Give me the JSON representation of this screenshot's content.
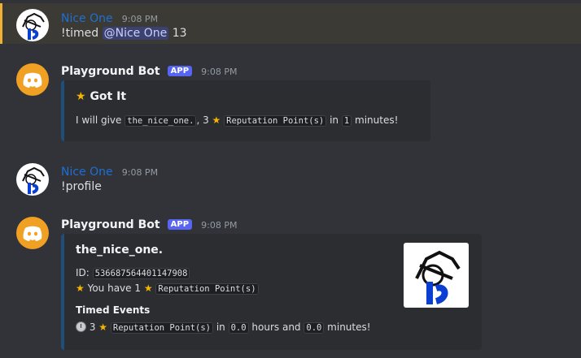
{
  "messages": [
    {
      "author": "Nice One",
      "time": "9:08 PM",
      "content_prefix": "!timed",
      "mention": "@Nice One",
      "content_suffix": "13"
    },
    {
      "author": "Playground Bot",
      "badge": "APP",
      "time": "9:08 PM",
      "embed": {
        "title": "Got It",
        "text_1": "I will give",
        "user_code": "the_nice_one.",
        "text_2": ", 3",
        "points_code": "Reputation Point(s)",
        "text_3": "in",
        "minutes_code": "1",
        "text_4": "minutes!"
      }
    },
    {
      "author": "Nice One",
      "time": "9:08 PM",
      "content": "!profile"
    },
    {
      "author": "Playground Bot",
      "badge": "APP",
      "time": "9:08 PM",
      "embed": {
        "title": "the_nice_one.",
        "id_label": "ID:",
        "id_value": "536687564401147908",
        "have_text": "You have 1",
        "points_code": "Reputation Point(s)",
        "field_title": "Timed Events",
        "timed_count": "3",
        "timed_in": "in",
        "hours_code": "0.0",
        "hours_and": "hours and",
        "minutes_code": "0.0",
        "minutes_text": "minutes!"
      }
    }
  ],
  "icons": {
    "star": "⭐",
    "clock": "clock-icon",
    "discord": "discord-logo-icon"
  },
  "colors": {
    "accent_blue": "#5865f2",
    "bot_avatar": "#f0a022",
    "mention_highlight": "#f0b132",
    "user_name": "#1e6fd1"
  }
}
